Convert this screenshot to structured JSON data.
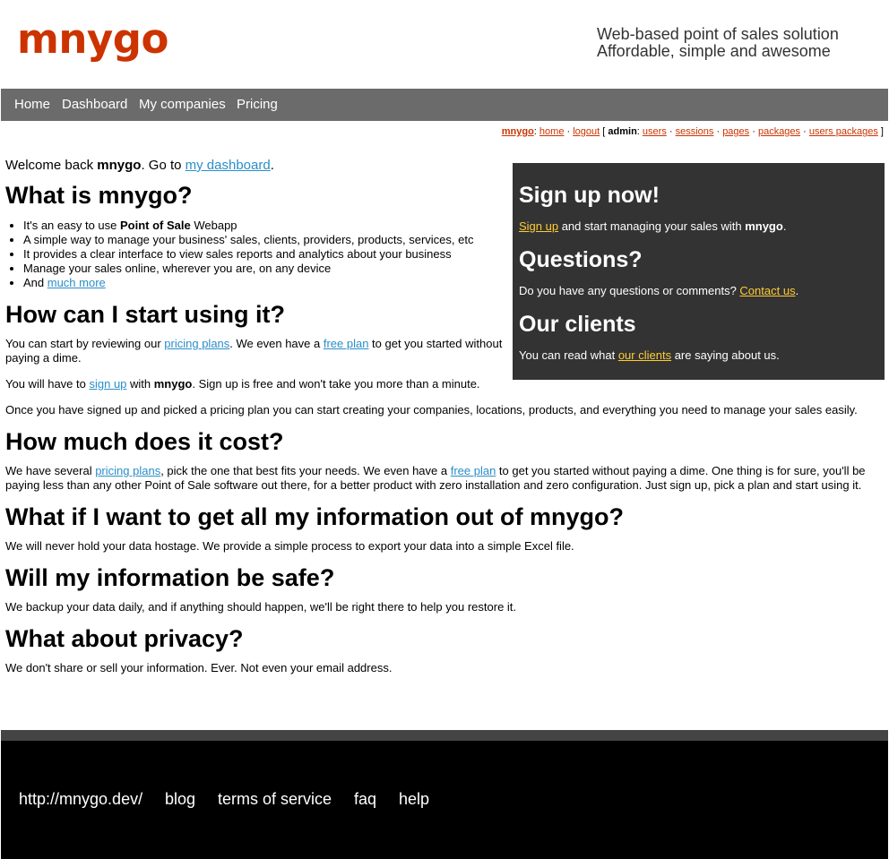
{
  "header": {
    "logo": "mnygo",
    "tagline_line1": "Web-based point of sales solution",
    "tagline_line2": "Affordable, simple and awesome"
  },
  "nav": {
    "home": "Home",
    "dashboard": "Dashboard",
    "my_companies": "My companies",
    "pricing": "Pricing"
  },
  "admin_bar": {
    "user": "mnygo",
    "home": "home",
    "logout": "logout",
    "admin_label": "admin",
    "users": "users",
    "sessions": "sessions",
    "pages": "pages",
    "packages": "packages",
    "users_packages": "users packages"
  },
  "welcome": {
    "prefix": "Welcome back ",
    "user": "mnygo",
    "middle": ". Go to ",
    "link": "my dashboard",
    "suffix": "."
  },
  "sections": {
    "what_is": {
      "title": "What is mnygo?",
      "bullets": {
        "b1_pre": "It's an easy to use ",
        "b1_bold": "Point of Sale",
        "b1_post": " Webapp",
        "b2": "A simple way to manage your business' sales, clients, providers, products, services, etc",
        "b3": "It provides a clear interface to view sales reports and analytics about your business",
        "b4": "Manage your sales online, wherever you are, on any device",
        "b5_pre": "And ",
        "b5_link": "much more"
      }
    },
    "start": {
      "title": "How can I start using it?",
      "p1_pre": "You can start by reviewing our ",
      "p1_link1": "pricing plans",
      "p1_mid": ". We even have a ",
      "p1_link2": "free plan",
      "p1_post": " to get you started without paying a dime.",
      "p2_pre": "You will have to ",
      "p2_link": "sign up",
      "p2_mid": " with ",
      "p2_bold": "mnygo",
      "p2_post": ". Sign up is free and won't take you more than a minute.",
      "p3": "Once you have signed up and picked a pricing plan you can start creating your companies, locations, products, and everything you need to manage your sales easily."
    },
    "cost": {
      "title": "How much does it cost?",
      "p_pre": "We have several ",
      "p_link1": "pricing plans",
      "p_mid": ", pick the one that best fits your needs. We even have a ",
      "p_link2": "free plan",
      "p_post": " to get you started without paying a dime. One thing is for sure, you'll be paying less than any other Point of Sale software out there, for a better product with zero installation and zero configuration. Just sign up, pick a plan and start using it."
    },
    "export": {
      "title": "What if I want to get all my information out of mnygo?",
      "p": "We will never hold your data hostage. We provide a simple process to export your data into a simple Excel file."
    },
    "safe": {
      "title": "Will my information be safe?",
      "p": "We backup your data daily, and if anything should happen, we'll be right there to help you restore it."
    },
    "privacy": {
      "title": "What about privacy?",
      "p": "We don't share or sell your information. Ever. Not even your email address."
    }
  },
  "sidebar": {
    "signup_title": "Sign up now!",
    "signup_link": "Sign up",
    "signup_mid": " and start managing your sales with ",
    "signup_bold": "mnygo",
    "signup_post": ".",
    "questions_title": "Questions?",
    "questions_pre": "Do you have any questions or comments? ",
    "questions_link": "Contact us",
    "questions_post": ".",
    "clients_title": "Our clients",
    "clients_pre": "You can read what ",
    "clients_link": "our clients",
    "clients_post": " are saying about us."
  },
  "footer": {
    "site": "http://mnygo.dev/",
    "blog": "blog",
    "terms": "terms of service",
    "faq": "faq",
    "help": "help"
  },
  "colors": {
    "brand": "#cc3300",
    "link": "#2a8ec8",
    "sidebar_link": "#ffcc33",
    "nav_bg": "#6b6b6b",
    "sidebar_bg": "#333333",
    "footer_bg": "#000000"
  }
}
